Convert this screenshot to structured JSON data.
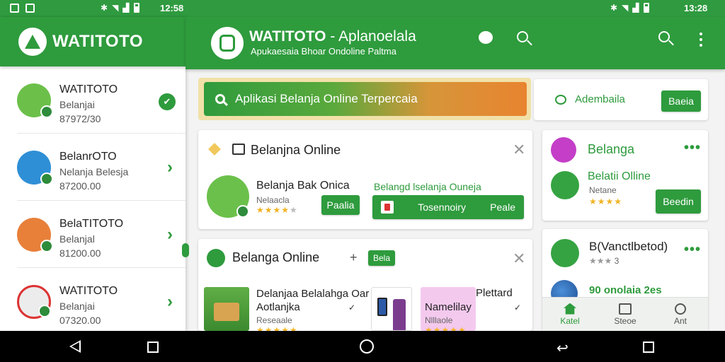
{
  "statusbar": {
    "time_left": "12:58",
    "time_right": "13:28"
  },
  "drawer": {
    "title": "WATITOTO",
    "items": [
      {
        "title": "WATITOTO",
        "sub": "Belanjai",
        "num": "87972/30",
        "avatar_color": "#6cc04a",
        "trailing": "check"
      },
      {
        "title": "BelanrOTO",
        "sub": "Nelanja Belesja",
        "num": "87200.00",
        "avatar_color": "#2f8fd6",
        "trailing": "chevron"
      },
      {
        "title": "BelaTITOTO",
        "sub": "Belanjal",
        "num": "81200.00",
        "avatar_color": "#e8803a",
        "trailing": "chevron"
      },
      {
        "title": "WATITOTO",
        "sub": "Belanjai",
        "num": "07320.00",
        "avatar_color": "#ececec",
        "trailing": "chevron"
      }
    ]
  },
  "header": {
    "title_bold": "WATITOTO",
    "title_rest": " - Aplanoelala",
    "subtitle": "Apukaesaia Bhoar Ondoline Paltma"
  },
  "search_banner": {
    "text": "Aplikasi Belanja Online Terpercaia"
  },
  "promo": {
    "label": "Adembaila",
    "button": "Baeia"
  },
  "card1": {
    "title": "Belanjna Online",
    "app_name": "Belanja Bak Onica",
    "app_sub": "Nelaacla",
    "stars": 4,
    "button": "Paalia",
    "link": "Belangd lselanja Ouneja",
    "wide_left": "Tosennoiry",
    "wide_right": "Peale"
  },
  "card2": {
    "title": "Belanga Online",
    "tag": "Bela",
    "item1_line1": "Delanjaa Belalahga Oar",
    "item1_line2": "Aotlanjka",
    "item1_sub": "Reseaale",
    "item2": "Namelilay",
    "item2_sub": "Nlllaole",
    "item3": "Plettard"
  },
  "card3": {
    "title": "Belanga",
    "app_name": "Belatii Olline",
    "app_sub": "Netane",
    "stars": 4,
    "button": "Beedin"
  },
  "card4": {
    "title": "B(Vanctlbetod)",
    "rating_text": "3",
    "footer_text": "90 onolaia 2es"
  },
  "bottom_nav": {
    "items": [
      "Katel",
      "Steoe",
      "Ant"
    ]
  },
  "colors": {
    "primary": "#2e9b3d",
    "banner_from": "#2f9b3c",
    "banner_to": "#e88430"
  }
}
